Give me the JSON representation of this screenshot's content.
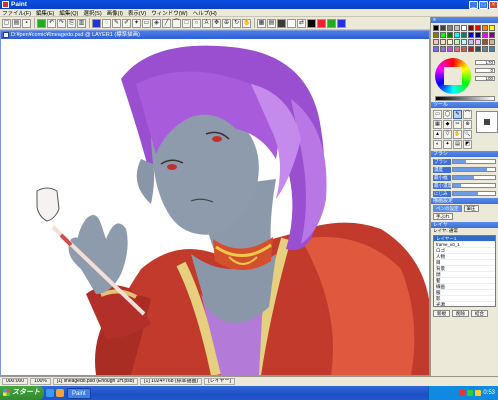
{
  "window": {
    "title": "Paint",
    "controls": [
      "_",
      "□",
      "×"
    ]
  },
  "menu": [
    "ファイル(F)",
    "編集(E)",
    "編集(Q)",
    "選択(S)",
    "画像(I)",
    "表示(V)",
    "ウィンドウ(W)",
    "ヘルプ(H)"
  ],
  "document": {
    "title": "D:¥pen¥comic¥lineagedo.psd  @ LAYER1 (標準描画)"
  },
  "palette": {
    "colors": [
      "#000000",
      "#404040",
      "#808080",
      "#c0c0c0",
      "#ffffff",
      "#800000",
      "#ff0000",
      "#ff8000",
      "#ffff00",
      "#808000",
      "#00ff00",
      "#008000",
      "#00ffff",
      "#008080",
      "#0000ff",
      "#000080",
      "#ff00ff",
      "#800080",
      "#ffc0c0",
      "#ffe0c0",
      "#ffffc0",
      "#c0ffc0",
      "#c0ffff",
      "#c0c0ff",
      "#ffc0ff",
      "#a0522d",
      "#d2b48c",
      "#7b68ee",
      "#9370db",
      "#ba55d3",
      "#db7093",
      "#cd5c5c",
      "#b22222",
      "#2f4f4f",
      "#708090",
      "#4682b4"
    ],
    "hsv_values": [
      "170",
      "0",
      "100"
    ]
  },
  "tool_panel": {
    "header": "ツール",
    "tools": [
      "▭",
      "◯",
      "✎",
      "⌒",
      "▦",
      "◆",
      "✂",
      "⊕",
      "▲",
      "▽",
      "✋",
      "🔍",
      "◐",
      "✦",
      "▤",
      "◩"
    ]
  },
  "brush_panel": {
    "header": "ブラシ",
    "rows": [
      {
        "label": "ブラシ",
        "fill": 0.3
      },
      {
        "label": "濃度",
        "fill": 0.8
      },
      {
        "label": "最小幅",
        "fill": 0.5
      },
      {
        "label": "最小濃度",
        "fill": 0.2
      },
      {
        "label": "にじみ",
        "fill": 0.6
      }
    ]
  },
  "options": {
    "header": "描画設定",
    "buttons": [
      "ペンの設定",
      "筆圧",
      "手ぶれ"
    ]
  },
  "layer_panel": {
    "header": "レイヤ",
    "mode_label": "レイヤ: 通常",
    "layers": [
      "レイヤー1",
      "frame_x0_1",
      "ロゴ",
      "人物",
      "目",
      "背景",
      "顔",
      "髪",
      "線画",
      "服",
      "影",
      "光源",
      "塗り"
    ],
    "selected_index": 0,
    "buttons": [
      "新規",
      "削除",
      "結合"
    ]
  },
  "status": {
    "cells": [
      "000:000",
      "100%",
      "[1] lineagedo.psd (Enough 1H.psd)",
      "[1] 1024×768 (標準描画)",
      "[レイヤー]"
    ]
  },
  "taskbar": {
    "start": "スタート",
    "tasks": [
      "Paint"
    ],
    "clock": "0:53"
  }
}
